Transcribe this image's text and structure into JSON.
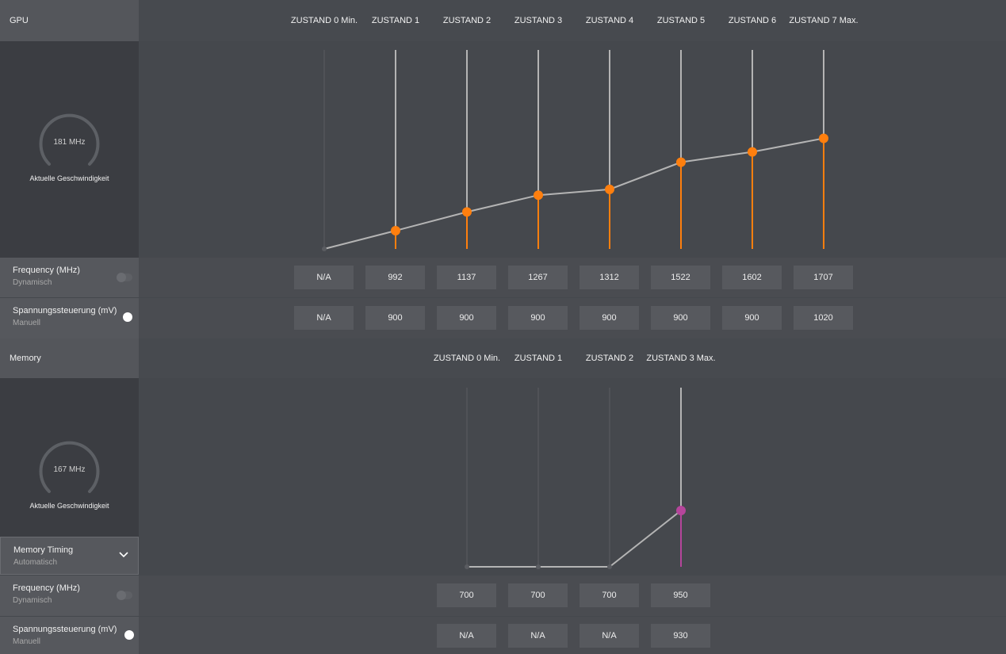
{
  "gpu": {
    "title": "GPU",
    "states": [
      "ZUSTAND 0 Min.",
      "ZUSTAND 1",
      "ZUSTAND 2",
      "ZUSTAND 3",
      "ZUSTAND 4",
      "ZUSTAND 5",
      "ZUSTAND 6",
      "ZUSTAND 7 Max."
    ],
    "current_speed": "181 MHz",
    "current_speed_label": "Aktuelle Geschwindigkeit",
    "frequency": {
      "label": "Frequency (MHz)",
      "mode": "Dynamisch",
      "values": [
        "N/A",
        "992",
        "1137",
        "1267",
        "1312",
        "1522",
        "1602",
        "1707"
      ]
    },
    "voltage": {
      "label": "Spannungssteuerung (mV)",
      "mode": "Manuell",
      "values": [
        "N/A",
        "900",
        "900",
        "900",
        "900",
        "900",
        "900",
        "1020"
      ]
    }
  },
  "memory": {
    "title": "Memory",
    "states": [
      "ZUSTAND 0 Min.",
      "ZUSTAND 1",
      "ZUSTAND 2",
      "ZUSTAND 3 Max."
    ],
    "current_speed": "167 MHz",
    "current_speed_label": "Aktuelle Geschwindigkeit",
    "timing": {
      "label": "Memory Timing",
      "mode": "Automatisch"
    },
    "frequency": {
      "label": "Frequency (MHz)",
      "mode": "Dynamisch",
      "values": [
        "700",
        "700",
        "700",
        "950"
      ]
    },
    "voltage": {
      "label": "Spannungssteuerung (mV)",
      "mode": "Manuell",
      "values": [
        "N/A",
        "N/A",
        "N/A",
        "930"
      ]
    }
  },
  "colors": {
    "gpu_accent": "#ff7f0e",
    "memory_accent": "#b5459b",
    "line": "#b4b4b4"
  }
}
